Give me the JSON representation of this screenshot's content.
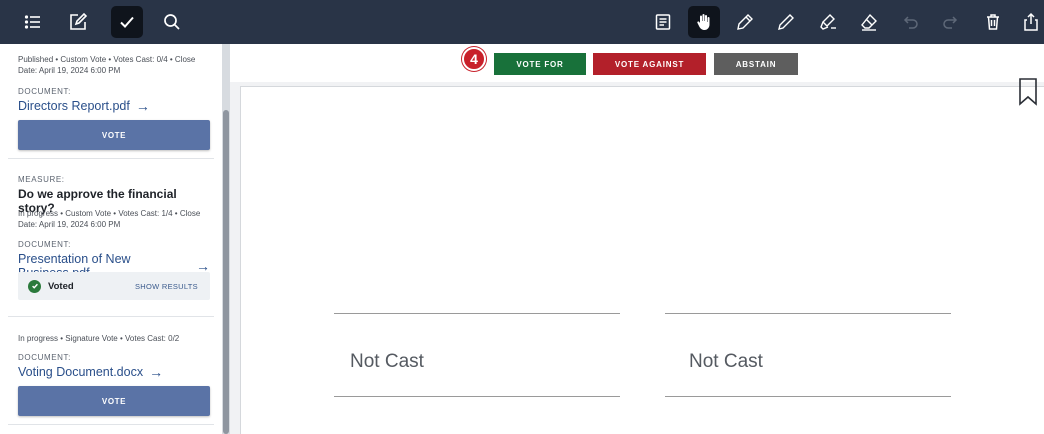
{
  "toolbar": {
    "left_icons": [
      "list-icon",
      "edit-note-icon",
      "checkmark-icon",
      "search-icon"
    ],
    "right_icons": [
      "notes-icon",
      "hand-icon",
      "pen-icon",
      "pencil-icon",
      "highlighter-icon",
      "eraser-icon",
      "undo-icon",
      "redo-icon",
      "trash-icon",
      "share-icon"
    ]
  },
  "sidebar": {
    "item1": {
      "meta": "Published • Custom Vote • Votes Cast: 0/4 • Close Date: April 19, 2024 6:00 PM",
      "doc_label": "DOCUMENT:",
      "doc_name": "Directors Report.pdf",
      "vote_label": "VOTE"
    },
    "item2": {
      "measure_label": "MEASURE:",
      "title": "Do we approve the financial story?",
      "meta": "In progress • Custom Vote • Votes Cast: 1/4 • Close Date: April 19, 2024 6:00 PM",
      "doc_label": "DOCUMENT:",
      "doc_name": "Presentation of New Business.pdf",
      "voted_label": "Voted",
      "show_results_label": "SHOW RESULTS"
    },
    "item3": {
      "meta": "In progress • Signature Vote • Votes Cast: 0/2",
      "doc_label": "DOCUMENT:",
      "doc_name": "Voting Document.docx",
      "vote_label": "VOTE"
    },
    "arrow": "→"
  },
  "vote_bar": {
    "step_number": "4",
    "vote_for": "VOTE FOR",
    "vote_against": "VOTE AGAINST",
    "abstain": "ABSTAIN"
  },
  "document": {
    "signature_left": "Not Cast",
    "signature_right": "Not Cast"
  },
  "colors": {
    "toolbar_bg": "#293447",
    "vote_for": "#18713a",
    "vote_against": "#b3202a",
    "abstain": "#5e5e5e",
    "sidebar_vote_button": "#5a73a6",
    "step_badge": "#c8202a"
  }
}
